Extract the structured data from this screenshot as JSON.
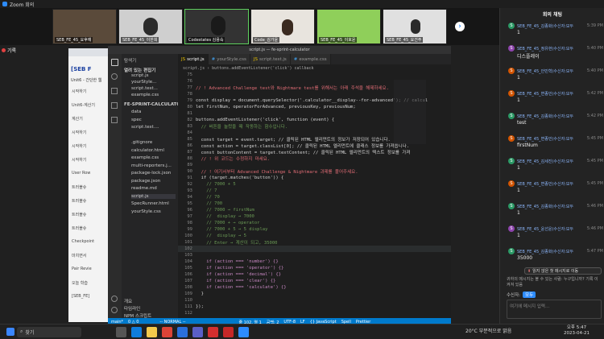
{
  "zoom": {
    "title": "Zoom 회의",
    "recording_label": "기록"
  },
  "participants": [
    {
      "name": "SEB_FE_45_요후예"
    },
    {
      "name": "SEB_FE_45_이한희"
    },
    {
      "name": "Codestates 김용숙"
    },
    {
      "name": "Code_김가윤"
    },
    {
      "name": "SEB_FE_45_이호윤"
    },
    {
      "name": "SEB_FE_45_요건주"
    }
  ],
  "browser": {
    "page_title": "[SEB F",
    "subtitle": "Unit6 - 간단한 웹",
    "items": [
      "시작하기",
      "Unit6-계산기",
      "계산기",
      "시작하기",
      "시작하기",
      "시작하기",
      "User Row",
      "트러블슈",
      "트러블슈",
      "트러블슈",
      "트러블슈",
      "Checkpoint",
      "마치면서",
      "Pair Revie",
      "오늘 학습",
      "[SEB_FE]"
    ]
  },
  "vscode": {
    "window_title": "script.js — fe-sprint-calculator",
    "sidebar_header": "탐색기",
    "open_editors": "열려 있는 편집기",
    "open_files": [
      "script.js",
      "yourStyle...",
      "script.test...",
      "example.css"
    ],
    "project": "FE-SPRINT-CALCULATOR",
    "tree": [
      "data",
      "spec",
      "script.test....",
      "",
      ".gitignore",
      "calculator.html",
      "example.css",
      "multi-reporters.j...",
      "package-lock.json",
      "package.json",
      "readme.md",
      "script.js",
      "SpecRunner.html",
      "yourStyle.css"
    ],
    "outline": "개요",
    "timeline": "타임라인",
    "npm": "NPM 스크립트",
    "tabs": [
      "script.js",
      "yourStyle.css",
      "script.test.js",
      "example.css"
    ],
    "breadcrumb": "script.js › buttons.addEventListener('click') callback",
    "code": [
      {
        "n": "75",
        "t": ""
      },
      {
        "n": "76",
        "t": ""
      },
      {
        "n": "77",
        "t": "// ! Advanced Challenge test와 Nightmare test를 위해서는 아래 주석을 해제하세요."
      },
      {
        "n": "78",
        "t": ""
      },
      {
        "n": "79",
        "t": "const display = document.querySelector('.calculator__display--for-advanced'); // calcul"
      },
      {
        "n": "80",
        "t": "let firstNum, operatorForAdvanced, previousKey, previousNum;"
      },
      {
        "n": "81",
        "t": ""
      },
      {
        "n": "82",
        "t": "buttons.addEventListener('click', function (event) {"
      },
      {
        "n": "83",
        "t": "  // 버튼을 눌렀을 때 작동하는 함수입니다."
      },
      {
        "n": "84",
        "t": ""
      },
      {
        "n": "85",
        "t": "  const target = event.target; // 클릭된 HTML 엘리먼트의 정보가 저장되어 있습니다."
      },
      {
        "n": "86",
        "t": "  const action = target.classList[0]; // 클릭된 HTML 엘리먼트에 클래스 정보를 가져옵니다."
      },
      {
        "n": "87",
        "t": "  const buttonContent = target.textContent; // 클릭된 HTML 엘리먼트의 텍스트 정보를 가져"
      },
      {
        "n": "88",
        "t": "  // ! 위 코드는 수정하지 마세요."
      },
      {
        "n": "89",
        "t": ""
      },
      {
        "n": "90",
        "t": "  // ! 여기서부터 Advanced Challenge & Nightmare 과제를 풀어주세요."
      },
      {
        "n": "91",
        "t": "  if (target.matches('button')) {"
      },
      {
        "n": "92",
        "t": "    // 7000 + 5"
      },
      {
        "n": "93",
        "t": "    // 7"
      },
      {
        "n": "94",
        "t": "    // 70"
      },
      {
        "n": "95",
        "t": "    // 700"
      },
      {
        "n": "96",
        "t": "    // 7000 → firstNum"
      },
      {
        "n": "97",
        "t": "    //  display → 7000"
      },
      {
        "n": "98",
        "t": "    // 7000 + → operator"
      },
      {
        "n": "99",
        "t": "    // 7000 + 5 → 5 display"
      },
      {
        "n": "100",
        "t": "    //  display → 5"
      },
      {
        "n": "101",
        "t": "    // Enter → 계산이 되고, 35000"
      },
      {
        "n": "102",
        "t": ""
      },
      {
        "n": "103",
        "t": ""
      },
      {
        "n": "104",
        "t": "    if (action === 'number') {}"
      },
      {
        "n": "105",
        "t": "    if (action === 'operator') {}"
      },
      {
        "n": "106",
        "t": "    if (action === 'decimal') {}"
      },
      {
        "n": "107",
        "t": "    if (action === 'clear') {}"
      },
      {
        "n": "108",
        "t": "    if (action === 'calculate') {}"
      },
      {
        "n": "109",
        "t": "  }"
      },
      {
        "n": "110",
        "t": ""
      },
      {
        "n": "111",
        "t": "});"
      },
      {
        "n": "112",
        "t": ""
      }
    ],
    "status": [
      "main*",
      "0 △ 0",
      "-- NORMAL --",
      "줄 102, 열 1",
      "공백: 2",
      "UTF-8",
      "LF",
      "{} JavaScript",
      "Spell",
      "Prettier"
    ]
  },
  "chat": {
    "title": "회의 채팅",
    "messages": [
      {
        "who": "SEB_FE_45_김종화(수신자:모두",
        "time": "5:39 PM",
        "text": "1",
        "color": "#2b9a66"
      },
      {
        "who": "SEB_FE_45_정유현(수신자:모두",
        "time": "5:40 PM",
        "text": "디스플레이",
        "color": "#8e44ad"
      },
      {
        "who": "SEB_FE_45_안민혁(수신자:모두",
        "time": "5:40 PM",
        "text": "1",
        "color": "#d35400"
      },
      {
        "who": "SEB_FE_45_변종민(수신자:모두",
        "time": "5:42 PM",
        "text": "1",
        "color": "#d35400"
      },
      {
        "who": "SEB_FE_45_김종화(수신자:모두",
        "time": "5:42 PM",
        "text": "test",
        "color": "#2b9a66"
      },
      {
        "who": "SEB_FE_45_변종민(수신자:모두",
        "time": "5:45 PM",
        "text": "firstNum",
        "color": "#d35400"
      },
      {
        "who": "SEB_FE_45_김세진(수신자:모두",
        "time": "5:45 PM",
        "text": "1",
        "color": "#2b9a66"
      },
      {
        "who": "SEB_FE_45_변종민(수신자:모두",
        "time": "5:45 PM",
        "text": "1",
        "color": "#d35400"
      },
      {
        "who": "SEB_FE_45_김종화(수신자:모두",
        "time": "5:46 PM",
        "text": "1",
        "color": "#2b9a66"
      },
      {
        "who": "SEB_FE_45_윤선윤(수신자:모두",
        "time": "5:46 PM",
        "text": "1",
        "color": "#8e44ad"
      },
      {
        "who": "SEB_FE_45_김종화(수신자:모두",
        "time": "5:47 PM",
        "text": "35000",
        "color": "#2b9a66"
      }
    ],
    "unread_label": "읽지 않은 첫 메시지로 이동",
    "notice": "귀하의 메시지는 볼 수 있는 사람: 누구입니까? 기록 이 켜져 있음",
    "recipient_label": "수신자:",
    "recipient_value": "모두",
    "input_placeholder": "여기에 메시지 입력..."
  },
  "taskbar": {
    "search_label": "찾기",
    "weather": "20°C 부분적으로 맑음",
    "time": "오후 5:47",
    "date": "2023-04-21"
  }
}
